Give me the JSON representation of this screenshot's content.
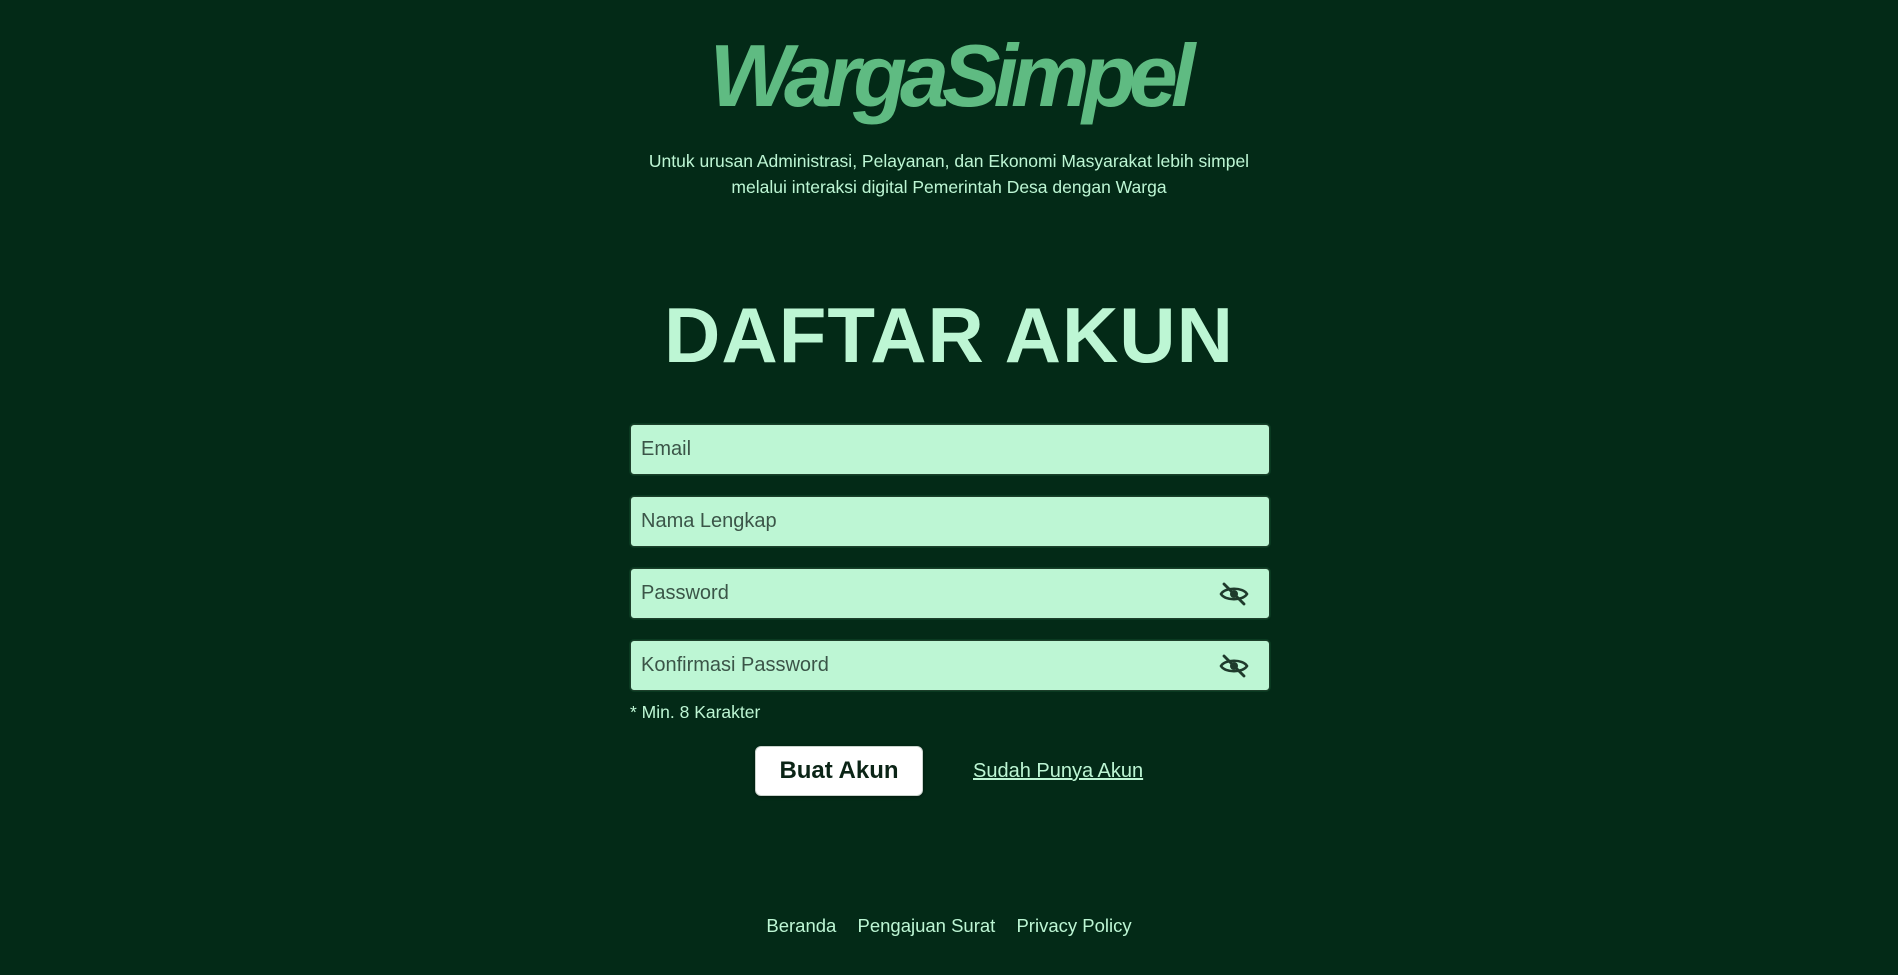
{
  "brand": {
    "logo_text": "WargaSimpel",
    "tagline_line1": "Untuk urusan Administrasi, Pelayanan, dan Ekonomi Masyarakat lebih simpel",
    "tagline_line2": "melalui interaksi digital Pemerintah Desa dengan Warga"
  },
  "form": {
    "title": "DAFTAR AKUN",
    "email_placeholder": "Email",
    "email_value": "",
    "fullname_placeholder": "Nama Lengkap",
    "fullname_value": "",
    "password_placeholder": "Password",
    "password_value": "",
    "confirm_placeholder": "Konfirmasi Password",
    "confirm_value": "",
    "password_icon": "eye-slash-icon",
    "hint": "* Min. 8 Karakter",
    "submit_label": "Buat Akun",
    "login_link_label": "Sudah Punya Akun"
  },
  "footer": {
    "links": [
      "Beranda",
      "Pengajuan Surat",
      "Privacy Policy"
    ]
  },
  "colors": {
    "background": "#032a17",
    "text": "#bdf6d4",
    "logo": "#5fbb82",
    "input_bg": "#bdf6d4",
    "button_bg": "#ffffff"
  }
}
